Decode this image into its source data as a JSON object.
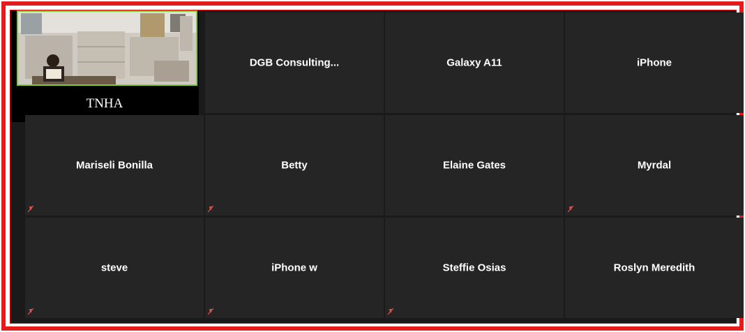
{
  "meeting": {
    "window_title": "",
    "accent_border_color": "#e31d1d",
    "active_speaker_color": "#7ccd3a"
  },
  "active_speaker": {
    "name": "TNHA",
    "video": true
  },
  "participants": [
    {
      "name": "DGB  Consulting...",
      "muted": false
    },
    {
      "name": "Galaxy A11",
      "muted": false
    },
    {
      "name": "iPhone",
      "muted": false
    },
    {
      "name": "Mariseli Bonilla",
      "muted": true
    },
    {
      "name": "Betty",
      "muted": true
    },
    {
      "name": "Elaine Gates",
      "muted": false
    },
    {
      "name": "Myrdal",
      "muted": true
    },
    {
      "name": "steve",
      "muted": true
    },
    {
      "name": "iPhone w",
      "muted": true
    },
    {
      "name": "Steffie Osias",
      "muted": true
    },
    {
      "name": "Roslyn Meredith",
      "muted": false
    }
  ],
  "icons": {
    "mute": "microphone-muted-icon"
  }
}
